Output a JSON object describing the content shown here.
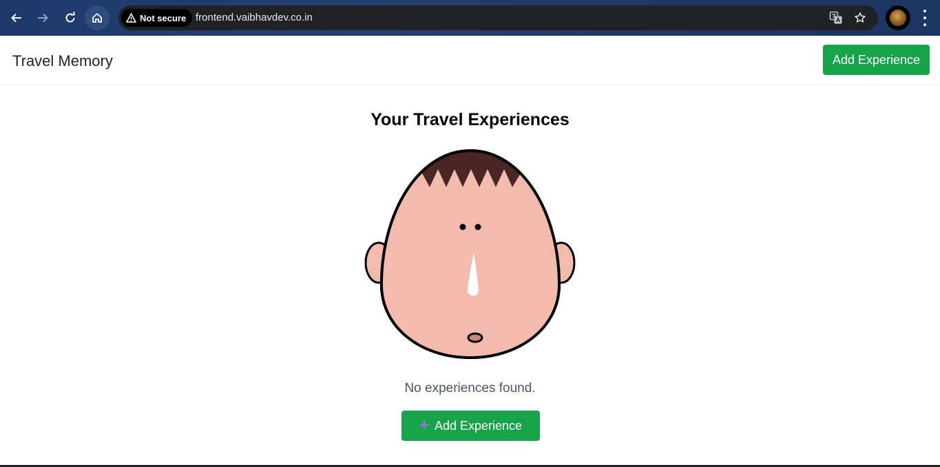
{
  "browser": {
    "security_label": "Not secure",
    "url": "frontend.vaibhavdev.co.in",
    "icons": [
      "back-arrow-icon",
      "forward-arrow-icon",
      "reload-icon",
      "home-icon",
      "warning-icon",
      "translate-icon",
      "star-icon",
      "profile-avatar",
      "more-vert-icon"
    ]
  },
  "header": {
    "brand": "Travel Memory",
    "add_button_label": "Add Experience"
  },
  "main": {
    "title": "Your Travel Experiences",
    "empty_message": "No experiences found.",
    "add_button_label": "Add Experience",
    "add_button_icon": "plus-icon"
  },
  "colors": {
    "accent_green": "#17a349",
    "skin": "#f2bbad",
    "hair": "#4a2724",
    "plus_icon": "#a56fd6"
  }
}
